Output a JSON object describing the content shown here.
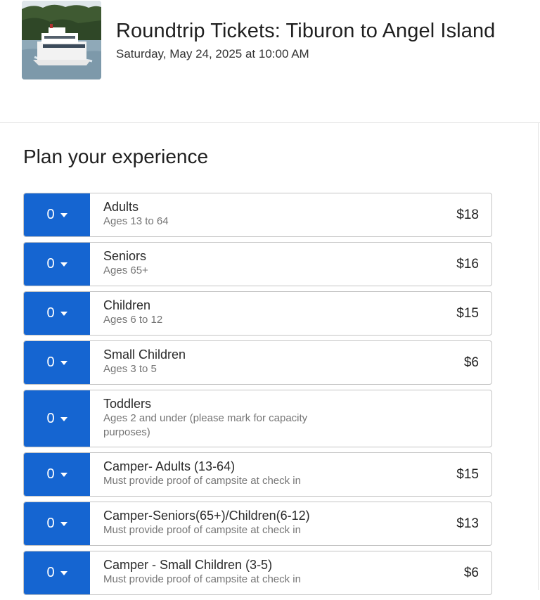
{
  "event": {
    "title": "Roundtrip Tickets: Tiburon to Angel Island",
    "date": "Saturday, May 24, 2025 at 10:00 AM",
    "image_icon": "ferry-boat-photo"
  },
  "section": {
    "title": "Plan your experience"
  },
  "tickets": [
    {
      "qty": "0",
      "name": "Adults",
      "desc": "Ages 13 to 64",
      "price": "$18"
    },
    {
      "qty": "0",
      "name": "Seniors",
      "desc": "Ages 65+",
      "price": "$16"
    },
    {
      "qty": "0",
      "name": "Children",
      "desc": "Ages 6 to 12",
      "price": "$15"
    },
    {
      "qty": "0",
      "name": "Small Children",
      "desc": "Ages 3 to 5",
      "price": "$6"
    },
    {
      "qty": "0",
      "name": "Toddlers",
      "desc": "Ages 2 and under (please mark for capacity purposes)",
      "price": ""
    },
    {
      "qty": "0",
      "name": "Camper- Adults (13-64)",
      "desc": "Must provide proof of campsite at check in",
      "price": "$15"
    },
    {
      "qty": "0",
      "name": "Camper-Seniors(65+)/Children(6-12)",
      "desc": "Must provide proof of campsite at check in",
      "price": "$13"
    },
    {
      "qty": "0",
      "name": "Camper - Small Children (3-5)",
      "desc": "Must provide proof of campsite at check in",
      "price": "$6"
    }
  ],
  "colors": {
    "accent": "#1565d1",
    "border": "#c4c4c4",
    "muted_text": "#757575"
  }
}
